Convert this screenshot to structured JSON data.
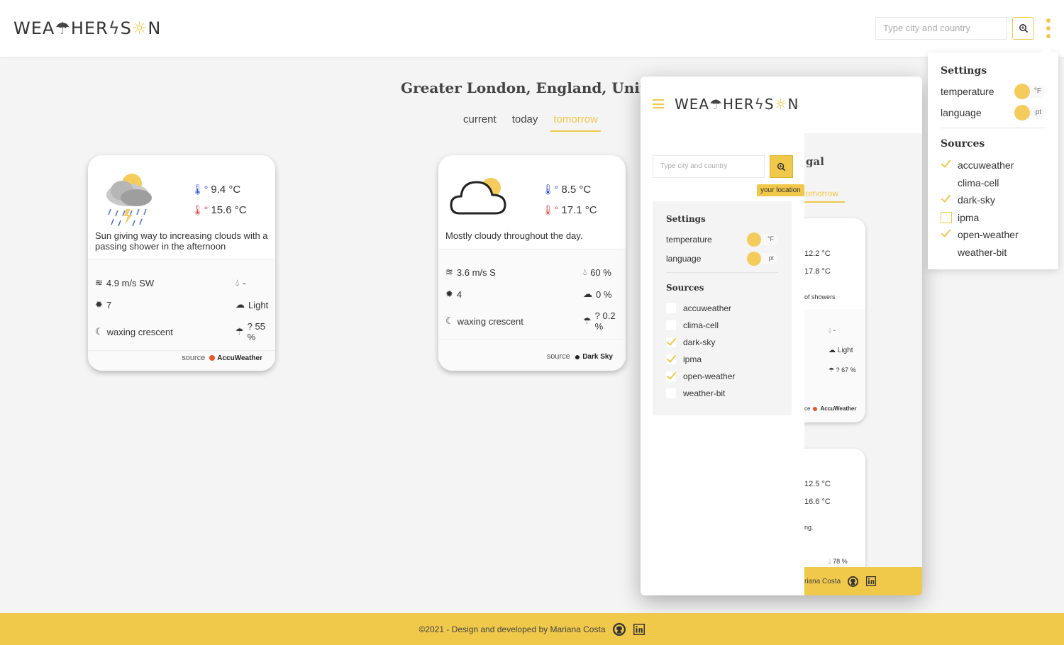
{
  "brand": {
    "logo_text_a": "WEA",
    "logo_text_b": "HER",
    "logo_text_c": "S",
    "logo_text_d": "N"
  },
  "header": {
    "search_placeholder": "Type city and country"
  },
  "location": {
    "title": "Greater London, England, United Kingdom"
  },
  "tabs": [
    {
      "label": "current"
    },
    {
      "label": "today"
    },
    {
      "label": "tomorrow"
    }
  ],
  "cards": [
    {
      "temp_min": "9.4 °C",
      "temp_max": "15.6 °C",
      "description": "Sun giving way to increasing clouds with a passing shower in the afternoon",
      "wind": "4.9 m/s SW",
      "humidity": "-",
      "uv": "7",
      "precip_type": "Light",
      "moon": "waxing crescent",
      "precip_prob": "? 55 %",
      "source_label": "source",
      "source_name": "AccuWeather"
    },
    {
      "temp_min": "8.5 °C",
      "temp_max": "17.1 °C",
      "description": "Mostly cloudy throughout the day.",
      "wind": "3.6 m/s S",
      "humidity": "60 %",
      "uv": "4",
      "precip_type": "0 %",
      "moon": "waxing crescent",
      "precip_prob": "? 0.2 %",
      "source_label": "source",
      "source_name": "Dark Sky"
    }
  ],
  "mobile": {
    "search_placeholder": "Type city and country",
    "tooltip": "your location",
    "settings_title": "Settings",
    "temperature_label": "temperature",
    "temperature_unit": "°F",
    "language_label": "language",
    "language_value": "pt",
    "sources_title": "Sources",
    "sources": [
      {
        "label": "accuweather",
        "checked": false
      },
      {
        "label": "clima-cell",
        "checked": false
      },
      {
        "label": "dark-sky",
        "checked": true
      },
      {
        "label": "ipma",
        "checked": true
      },
      {
        "label": "open-weather",
        "checked": true
      },
      {
        "label": "weather-bit",
        "checked": false
      }
    ],
    "bg_title_fragment": "gal",
    "bg_tab_fragment": "tomorrow",
    "bg_card1": {
      "t1": "12.2 °C",
      "t2": "17.8 °C",
      "desc": "of showers",
      "hum": "-",
      "precip": "Light",
      "prob": "? 67 %",
      "src": "AccuWeather",
      "src_label": "ce"
    },
    "bg_card2": {
      "t1": "12.5 °C",
      "t2": "16.6 °C",
      "desc": "ng.",
      "hum": "78 %"
    },
    "footer_text": "riana Costa"
  },
  "panel": {
    "settings_title": "Settings",
    "temperature_label": "temperature",
    "temperature_unit": "°F",
    "language_label": "language",
    "language_value": "pt",
    "sources_title": "Sources",
    "sources": [
      {
        "label": "accuweather",
        "checked": true
      },
      {
        "label": "clima-cell",
        "checked": false
      },
      {
        "label": "dark-sky",
        "checked": true
      },
      {
        "label": "ipma",
        "checked": false
      },
      {
        "label": "open-weather",
        "checked": true
      },
      {
        "label": "weather-bit",
        "checked": false
      }
    ]
  },
  "footer": {
    "text": "©2021 - Design and developed by Mariana Costa"
  },
  "colors": {
    "accent": "#f0c84a",
    "background": "#f4f4f4",
    "cold": "#2845d6",
    "hot": "#d64545"
  }
}
